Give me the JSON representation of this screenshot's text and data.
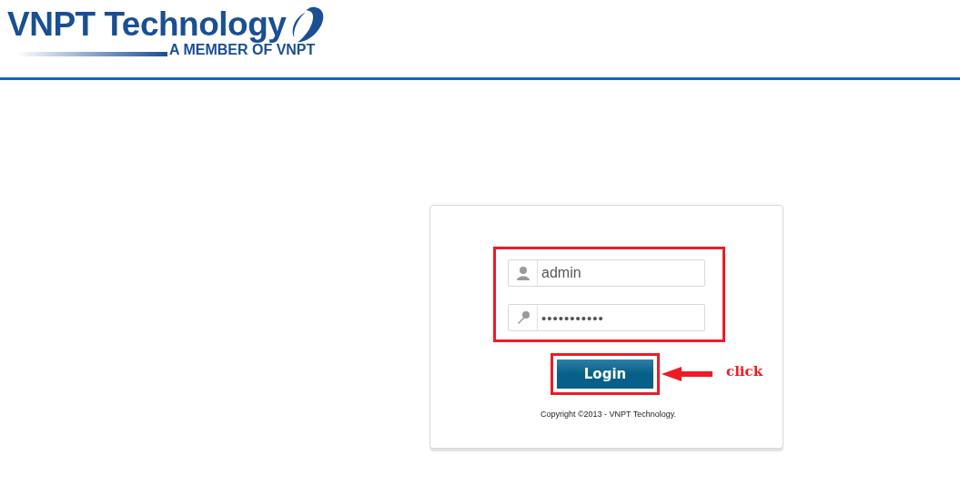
{
  "header": {
    "brand": "VNPT Technology",
    "tagline": "A MEMBER OF VNPT"
  },
  "login": {
    "fields": [
      {
        "kind": "user",
        "value": "admin"
      },
      {
        "kind": "password",
        "value": "•••••••••••"
      }
    ],
    "button": "Login",
    "annotation": "click",
    "copyright": "Copyright ©2013 - VNPT Technology."
  }
}
